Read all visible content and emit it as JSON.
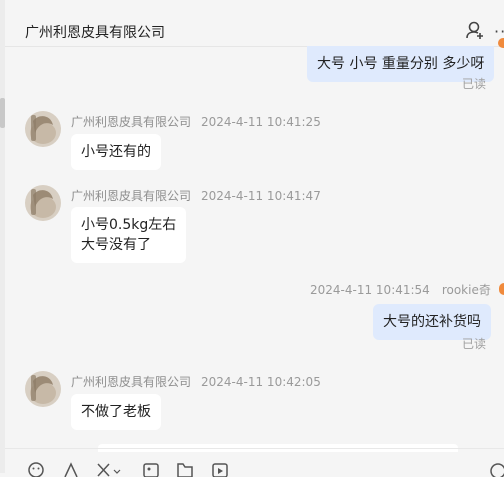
{
  "header": {
    "title": "广州利恩皮具有限公司",
    "more_label": "···"
  },
  "messages": [
    {
      "id": "m1",
      "from": "me",
      "text": "大号 小号 重量分别 多少呀",
      "read": "已读"
    },
    {
      "id": "m2",
      "from": "other",
      "sender": "广州利恩皮具有限公司",
      "time": "2024-4-11 10:41:25",
      "lines": [
        "小号还有的"
      ]
    },
    {
      "id": "m3",
      "from": "other",
      "sender": "广州利恩皮具有限公司",
      "time": "2024-4-11 10:41:47",
      "lines": [
        "小号0.5kg左右",
        "大号没有了"
      ]
    },
    {
      "id": "m4",
      "from": "me",
      "sender": "rookie奇",
      "time": "2024-4-11 10:41:54",
      "text": "大号的还补货吗",
      "read": "已读"
    },
    {
      "id": "m5",
      "from": "other",
      "sender": "广州利恩皮具有限公司",
      "time": "2024-4-11 10:42:05",
      "lines": [
        "不做了老板"
      ]
    }
  ],
  "toolbar": {
    "items": [
      "emoji-icon",
      "text-format-icon",
      "scissors-icon",
      "image-icon",
      "folder-icon",
      "video-icon",
      "message-icon"
    ]
  }
}
